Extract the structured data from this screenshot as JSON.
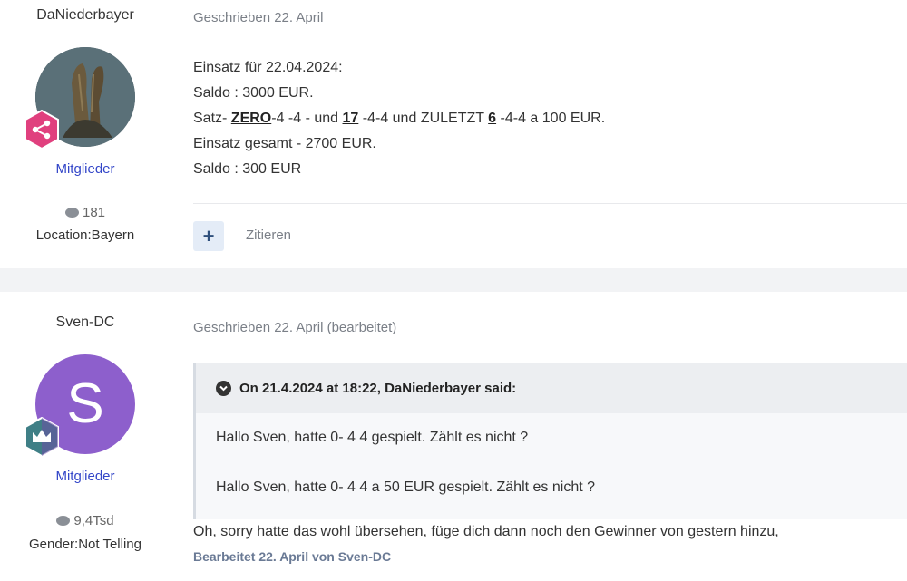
{
  "posts": [
    {
      "author": "DaNiederbayer",
      "group": "Mitglieder",
      "post_count": "181",
      "meta": "Location:Bayern",
      "date": "Geschrieben 22. April",
      "lines": {
        "l1": "Einsatz für 22.04.2024:",
        "l2": "Saldo : 3000 EUR.",
        "l3a": "Satz- ",
        "l3b": "ZERO",
        "l3c": "-4 -4 - und ",
        "l3d": "17",
        "l3e": " -4-4 und ZULETZT ",
        "l3f": "6",
        "l3g": " -4-4 a 100 EUR.",
        "l4": "Einsatz gesamt - 2700 EUR.",
        "l5": "Saldo : 300 EUR"
      },
      "actions": {
        "plus": "+",
        "quote": "Zitieren"
      }
    },
    {
      "author": "Sven-DC",
      "avatar_letter": "S",
      "group": "Mitglieder",
      "post_count": "9,4Tsd",
      "meta": "Gender:Not Telling",
      "date": "Geschrieben 22. April (bearbeitet)",
      "quote": {
        "header": "On 21.4.2024 at 18:22, DaNiederbayer said:",
        "line1": "Hallo Sven, hatte 0- 4 4 gespielt. Zählt es nicht ?",
        "line2": "Hallo Sven, hatte 0- 4 4 a 50 EUR  gespielt. Zählt es nicht ?"
      },
      "reply": "Oh, sorry hatte das wohl übersehen, füge dich dann noch den Gewinner von gestern hinzu,",
      "edited": "Bearbeitet 22. April von Sven-DC"
    }
  ],
  "colors": {
    "accent_blue": "#3346c8",
    "badge_pink": "#e0407e",
    "avatar_purple": "#8d5fcc",
    "badge_teal": "#3f7f86"
  }
}
